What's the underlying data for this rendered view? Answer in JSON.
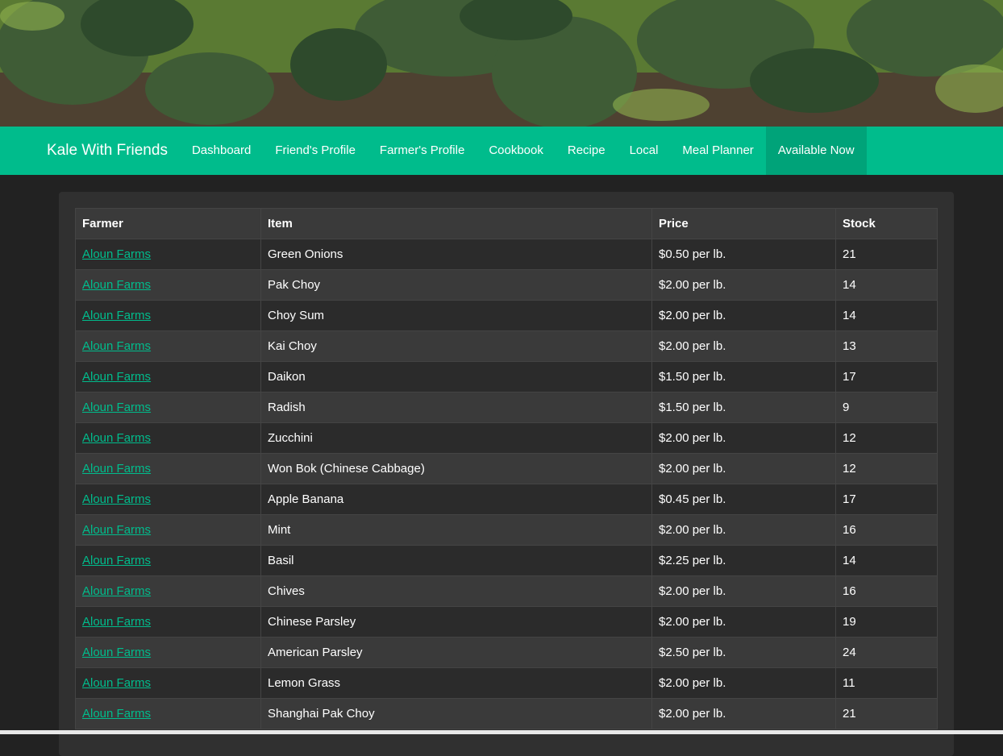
{
  "brand": "Kale With Friends",
  "nav": {
    "items": [
      {
        "label": "Dashboard"
      },
      {
        "label": "Friend's Profile"
      },
      {
        "label": "Farmer's Profile"
      },
      {
        "label": "Cookbook"
      },
      {
        "label": "Recipe"
      },
      {
        "label": "Local"
      },
      {
        "label": "Meal Planner"
      },
      {
        "label": "Available Now",
        "active": true
      }
    ]
  },
  "table": {
    "headers": {
      "farmer": "Farmer",
      "item": "Item",
      "price": "Price",
      "stock": "Stock"
    },
    "rows": [
      {
        "farmer": "Aloun Farms",
        "item": "Green Onions",
        "price": "$0.50 per lb.",
        "stock": "21"
      },
      {
        "farmer": "Aloun Farms",
        "item": "Pak Choy",
        "price": "$2.00 per lb.",
        "stock": "14"
      },
      {
        "farmer": "Aloun Farms",
        "item": "Choy Sum",
        "price": "$2.00 per lb.",
        "stock": "14"
      },
      {
        "farmer": "Aloun Farms",
        "item": "Kai Choy",
        "price": "$2.00 per lb.",
        "stock": "13"
      },
      {
        "farmer": "Aloun Farms",
        "item": "Daikon",
        "price": "$1.50 per lb.",
        "stock": "17"
      },
      {
        "farmer": "Aloun Farms",
        "item": "Radish",
        "price": "$1.50 per lb.",
        "stock": "9"
      },
      {
        "farmer": "Aloun Farms",
        "item": "Zucchini",
        "price": "$2.00 per lb.",
        "stock": "12"
      },
      {
        "farmer": "Aloun Farms",
        "item": "Won Bok (Chinese Cabbage)",
        "price": "$2.00 per lb.",
        "stock": "12"
      },
      {
        "farmer": "Aloun Farms",
        "item": "Apple Banana",
        "price": "$0.45 per lb.",
        "stock": "17"
      },
      {
        "farmer": "Aloun Farms",
        "item": "Mint",
        "price": "$2.00 per lb.",
        "stock": "16"
      },
      {
        "farmer": "Aloun Farms",
        "item": "Basil",
        "price": "$2.25 per lb.",
        "stock": "14"
      },
      {
        "farmer": "Aloun Farms",
        "item": "Chives",
        "price": "$2.00 per lb.",
        "stock": "16"
      },
      {
        "farmer": "Aloun Farms",
        "item": "Chinese Parsley",
        "price": "$2.00 per lb.",
        "stock": "19"
      },
      {
        "farmer": "Aloun Farms",
        "item": "American Parsley",
        "price": "$2.50 per lb.",
        "stock": "24"
      },
      {
        "farmer": "Aloun Farms",
        "item": "Lemon Grass",
        "price": "$2.00 per lb.",
        "stock": "11"
      },
      {
        "farmer": "Aloun Farms",
        "item": "Shanghai Pak Choy",
        "price": "$2.00 per lb.",
        "stock": "21"
      }
    ]
  },
  "colors": {
    "accent": "#00bc8c",
    "accent_active": "#00a379",
    "background": "#222222",
    "panel": "#303030"
  }
}
